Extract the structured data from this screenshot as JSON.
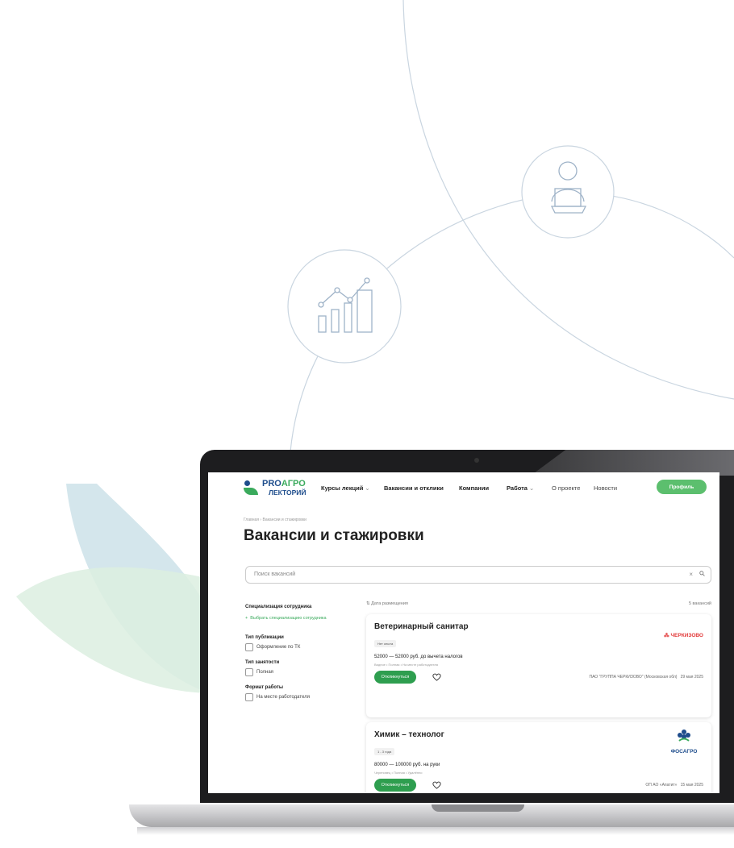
{
  "nav": {
    "logo_top_pro": "PRO",
    "logo_top_agro": "АГРО",
    "logo_bottom": "ЛЕКТОРИЙ",
    "items": [
      "Курсы лекций",
      "Вакансии и отклики",
      "Компании",
      "Работа",
      "О проекте",
      "Новости"
    ],
    "profile_button": "Профиль"
  },
  "breadcrumb": [
    "Главная",
    "Вакансии и стажировки"
  ],
  "page_title": "Вакансии и стажировки",
  "search": {
    "placeholder": "Поиск вакансий",
    "clear": "×"
  },
  "filters": {
    "spec_title": "Специализация сотрудника",
    "spec_add": "Выбрать специализацию сотрудника",
    "pub_title": "Тип публикации",
    "pub_option": "Оформление по ТК",
    "emp_title": "Тип занятости",
    "emp_option": "Полная",
    "format_title": "Формат работы",
    "format_option": "На месте работодателя"
  },
  "sort_label": "Дата размещения",
  "results_count": "5 вакансий",
  "vacancies": [
    {
      "title": "Ветеринарный санитар",
      "badge": "Нет опыта",
      "salary": "52000 — 52000 руб. до вычета налогов",
      "meta": "Видное • Полная • На месте работодателя",
      "apply": "Откликнуться",
      "company": "ПАО \"ГРУППА ЧЕРКИЗОВО\" (Московская обл)",
      "date": "29 мая 2025",
      "logo_text": "ЧЕРКИЗОВО"
    },
    {
      "title": "Химик – технолог",
      "badge": "1 - 3 года",
      "salary": "80000 — 100000 руб. на руки",
      "meta": "Череповец • Полная • Удалённо",
      "apply": "Откликнуться",
      "company": "ОП АО «Апатит»",
      "date": "15 мая 2025",
      "logo_text": "ФОСАГРО"
    }
  ],
  "colors": {
    "brand_green": "#2e9e4f",
    "brand_blue": "#1e4d8c",
    "accent_light_green": "#5cbf6e"
  }
}
